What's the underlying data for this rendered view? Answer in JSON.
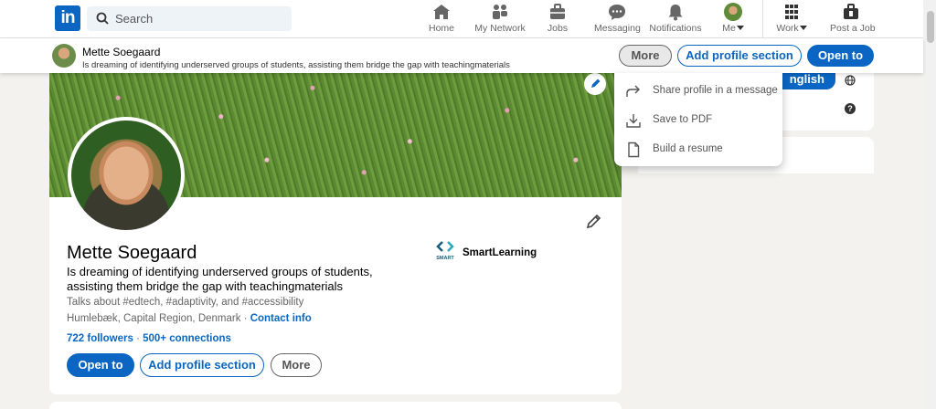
{
  "nav": {
    "logo_text": "in",
    "search_placeholder": "Search",
    "items": [
      {
        "label": "Home",
        "icon": "home-icon"
      },
      {
        "label": "My Network",
        "icon": "network-icon"
      },
      {
        "label": "Jobs",
        "icon": "briefcase-icon"
      },
      {
        "label": "Messaging",
        "icon": "messaging-icon"
      },
      {
        "label": "Notifications",
        "icon": "bell-icon"
      },
      {
        "label": "Me",
        "icon": "avatar"
      },
      {
        "label": "Work",
        "icon": "grid-icon"
      },
      {
        "label": "Post a Job",
        "icon": "post-job-icon"
      }
    ]
  },
  "sticky": {
    "name": "Mette Soegaard",
    "headline": "Is dreaming of identifying underserved groups of students, assisting them bridge the gap with teachingmaterials",
    "more_label": "More",
    "add_label": "Add profile section",
    "open_label": "Open to"
  },
  "dropdown": {
    "items": [
      {
        "label": "Share profile in a message",
        "icon": "share-arrow-icon"
      },
      {
        "label": "Save to PDF",
        "icon": "download-icon"
      },
      {
        "label": "Build a resume",
        "icon": "document-icon"
      }
    ]
  },
  "profile": {
    "name": "Mette Soegaard",
    "headline": "Is dreaming of identifying underserved groups of students, assisting them bridge the gap with teachingmaterials",
    "talks_about": "Talks about #edtech, #adaptivity, and #accessibility",
    "location": "Humlebæk, Capital Region, Denmark",
    "location_sep": " · ",
    "contact_label": "Contact info",
    "followers": "722 followers",
    "stats_sep": " · ",
    "connections": "500+ connections",
    "open_label": "Open to",
    "add_label": "Add profile section",
    "more_label": "More",
    "company_name": "SmartLearning",
    "company_logo_text": "SMART"
  },
  "right": {
    "language_label": "nglish",
    "help_symbol": "?"
  },
  "colors": {
    "brand": "#0a66c2",
    "page_bg": "#f3f2ef"
  }
}
